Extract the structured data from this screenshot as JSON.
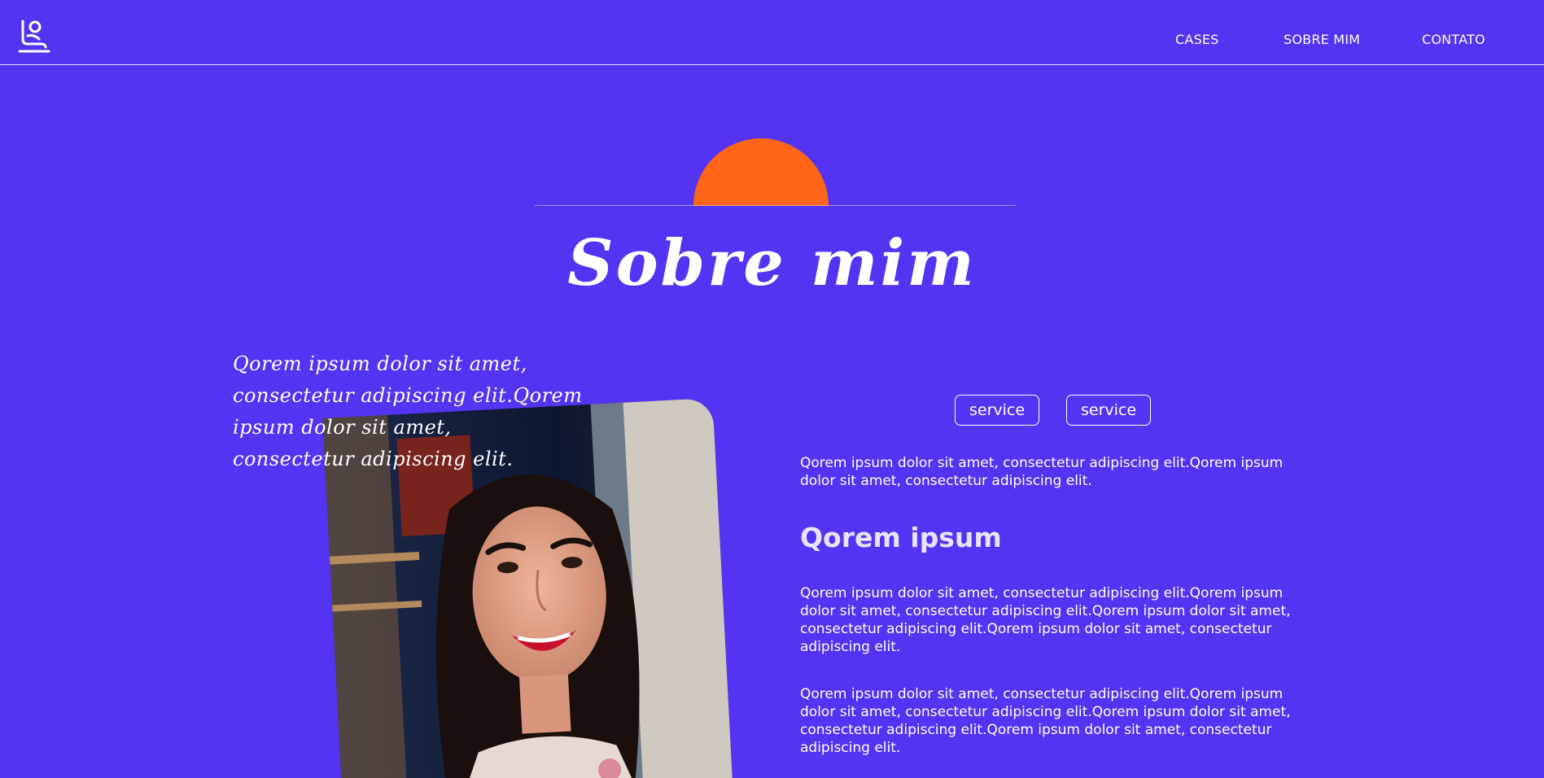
{
  "header": {
    "logo_icon": "seated-figure-logo-icon",
    "nav": [
      {
        "label": "CASES"
      },
      {
        "label": "SOBRE MIM"
      },
      {
        "label": "CONTATO"
      }
    ]
  },
  "hero": {
    "title": "Sobre mim",
    "sun_color": "#FF6516"
  },
  "left": {
    "handwritten_lines": [
      "Qorem ipsum dolor sit amet,",
      "consectetur adipiscing elit.Qorem",
      "ipsum dolor sit amet,",
      "consectetur adipiscing elit."
    ]
  },
  "right": {
    "chips": [
      {
        "label": "service"
      },
      {
        "label": "service"
      }
    ],
    "intro": "Qorem ipsum dolor sit amet, consectetur adipiscing elit.Qorem ipsum dolor sit amet, consectetur adipiscing elit.",
    "subheading": "Qorem ipsum",
    "paragraphs": [
      "Qorem ipsum dolor sit amet, consectetur adipiscing elit.Qorem ipsum dolor sit amet, consectetur adipiscing elit.Qorem ipsum dolor sit amet, consectetur adipiscing elit.Qorem ipsum dolor sit amet, consectetur adipiscing elit.",
      "Qorem ipsum dolor sit amet, consectetur adipiscing elit.Qorem ipsum dolor sit amet, consectetur adipiscing elit.Qorem ipsum dolor sit amet, consectetur adipiscing elit.Qorem ipsum dolor sit amet, consectetur adipiscing elit."
    ]
  },
  "colors": {
    "background": "#5434F2",
    "accent": "#FF6516",
    "text": "#FFFFFF",
    "subheading": "#E9E3FF"
  }
}
